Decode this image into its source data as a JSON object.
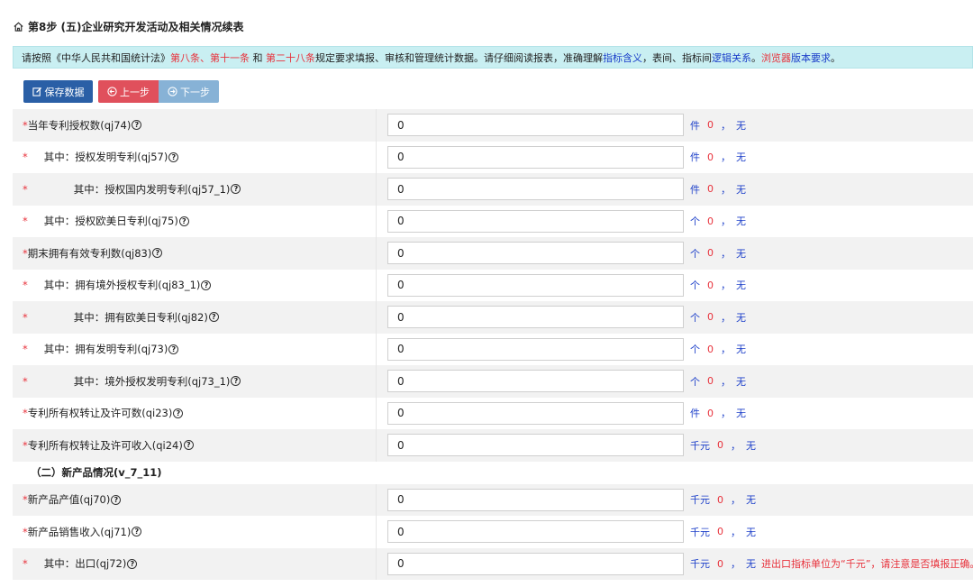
{
  "header": {
    "title": "第8步 (五)企业研究开发活动及相关情况续表",
    "home_icon": "home-icon"
  },
  "notice": {
    "p1": "请按照《中华人民共和国统计法》",
    "l1": "第八条",
    "p2": "、",
    "l2": "第十一条",
    "p3": " 和 ",
    "l3": "第二十八条",
    "p4": " 规定要求填报、审核和管理统计数据。请仔细阅读报表，准确理解",
    "l4": "指标含义",
    "p5": "，表间、指标间",
    "l5": "逻辑关系",
    "p6": "。",
    "l6": "浏览器",
    "l7": "版本要求",
    "p7": "。"
  },
  "toolbar": {
    "save_label": "保存数据",
    "prev_label": "上一步",
    "next_label": "下一步"
  },
  "rows": [
    {
      "label": "当年专利授权数(qj74)",
      "value": "0",
      "unit": "件",
      "count": "0",
      "sep": "，",
      "status": "无"
    },
    {
      "label": "其中：授权发明专利(qj57)",
      "value": "0",
      "unit": "件",
      "count": "0",
      "sep": "，",
      "status": "无"
    },
    {
      "label": "其中：授权国内发明专利(qj57_1)",
      "value": "0",
      "unit": "件",
      "count": "0",
      "sep": "，",
      "status": "无"
    },
    {
      "label": "其中：授权欧美日专利(qj75)",
      "value": "0",
      "unit": "个",
      "count": "0",
      "sep": "，",
      "status": "无"
    },
    {
      "label": "期末拥有有效专利数(qj83)",
      "value": "0",
      "unit": "个",
      "count": "0",
      "sep": "，",
      "status": "无"
    },
    {
      "label": "其中：拥有境外授权专利(qj83_1)",
      "value": "0",
      "unit": "个",
      "count": "0",
      "sep": "，",
      "status": "无"
    },
    {
      "label": "其中：拥有欧美日专利(qj82)",
      "value": "0",
      "unit": "个",
      "count": "0",
      "sep": "，",
      "status": "无"
    },
    {
      "label": "其中：拥有发明专利(qj73)",
      "value": "0",
      "unit": "个",
      "count": "0",
      "sep": "，",
      "status": "无"
    },
    {
      "label": "其中：境外授权发明专利(qj73_1)",
      "value": "0",
      "unit": "个",
      "count": "0",
      "sep": "，",
      "status": "无"
    },
    {
      "label": "专利所有权转让及许可数(qi23)",
      "value": "0",
      "unit": "件",
      "count": "0",
      "sep": "，",
      "status": "无"
    },
    {
      "label": "专利所有权转让及许可收入(qi24)",
      "value": "0",
      "unit": "千元",
      "count": "0",
      "sep": "，",
      "status": "无"
    }
  ],
  "section": {
    "title": "（二）新产品情况(v_7_11)"
  },
  "rows2": [
    {
      "label": "新产品产值(qj70)",
      "value": "0",
      "unit": "千元",
      "count": "0",
      "sep": "，",
      "status": "无"
    },
    {
      "label": "新产品销售收入(qj71)",
      "value": "0",
      "unit": "千元",
      "count": "0",
      "sep": "，",
      "status": "无"
    },
    {
      "label": "其中：出口(qj72)",
      "value": "0",
      "unit": "千元",
      "count": "0",
      "sep": "，",
      "status": "无",
      "warning": "进出口指标单位为“千元”，请注意是否填报正确。"
    }
  ],
  "colors": {
    "accent": "#2a5fa6",
    "danger": "#e8323c",
    "link": "#1c3fc9",
    "notice_bg": "#c9eff2"
  }
}
